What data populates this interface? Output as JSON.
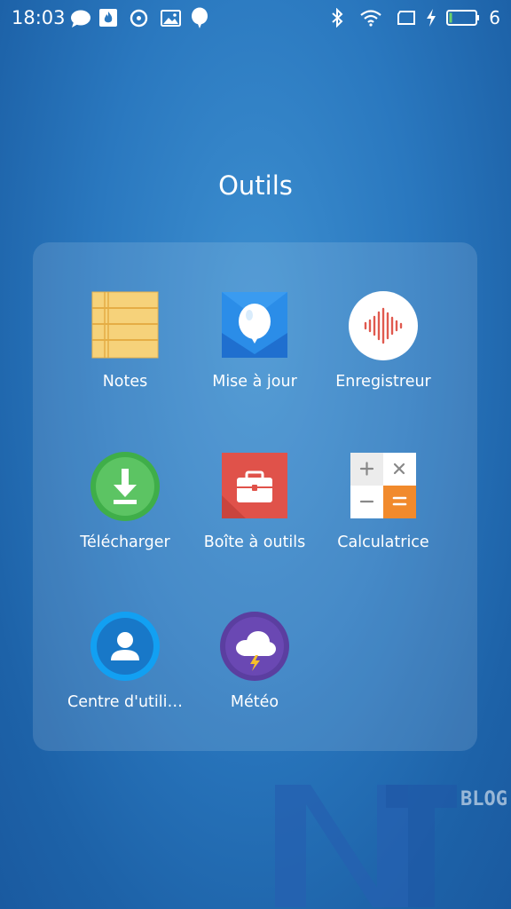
{
  "status_bar": {
    "time": "18:03",
    "battery_level": "6",
    "left_icons": [
      "chat-bubble-icon",
      "flame-app-icon",
      "circle-app-icon",
      "image-icon",
      "balloon-icon"
    ],
    "right_icons": [
      "bluetooth-icon",
      "wifi-icon",
      "screen-rotation-icon",
      "charging-icon",
      "battery-icon"
    ]
  },
  "folder": {
    "title": "Outils",
    "apps": [
      {
        "label": "Notes",
        "icon": "notes-icon"
      },
      {
        "label": "Mise à jour",
        "icon": "update-balloon-icon"
      },
      {
        "label": "Enregistreur",
        "icon": "recorder-icon"
      },
      {
        "label": "Télécharger",
        "icon": "download-icon"
      },
      {
        "label": "Boîte à outils",
        "icon": "toolbox-icon"
      },
      {
        "label": "Calculatrice",
        "icon": "calculator-icon"
      },
      {
        "label": "Centre d'utili…",
        "icon": "user-center-icon"
      },
      {
        "label": "Météo",
        "icon": "weather-icon"
      }
    ]
  },
  "watermark": {
    "text": "BLOG"
  },
  "colors": {
    "background": "#2a78bf",
    "notes": "#f6cf6e",
    "update": "#2b8de8",
    "recorder_wave": "#e05a4f",
    "download": "#4caf50",
    "toolbox": "#e0524a",
    "calculator_accent": "#f18a2c",
    "user_center": "#1e9bef",
    "weather": "#5b3ea0"
  }
}
